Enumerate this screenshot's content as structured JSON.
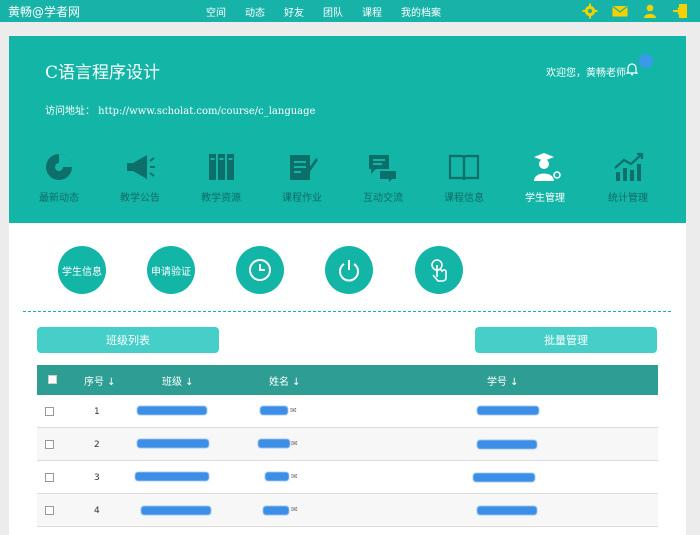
{
  "topbar": {
    "site_name": "黄畅@学者网",
    "nav": [
      "空间",
      "动态",
      "好友",
      "团队",
      "课程",
      "我的档案"
    ],
    "icons": [
      "settings-icon",
      "mail-icon",
      "user-icon",
      "logout-icon"
    ],
    "color": "#17b3a8"
  },
  "course": {
    "title": "C语言程序设计",
    "welcome": "欢迎您，黄畅老师",
    "access_url": "访问地址： http://www.scholat.com/course/c_language"
  },
  "modules": [
    {
      "label": "最新动态",
      "icon": "pie-chart-icon"
    },
    {
      "label": "教学公告",
      "icon": "megaphone-icon"
    },
    {
      "label": "教学资源",
      "icon": "binders-icon"
    },
    {
      "label": "课程作业",
      "icon": "edit-doc-icon"
    },
    {
      "label": "互动交流",
      "icon": "chat-icon"
    },
    {
      "label": "课程信息",
      "icon": "book-icon"
    },
    {
      "label": "学生管理",
      "icon": "graduate-icon",
      "active": true
    },
    {
      "label": "统计管理",
      "icon": "trend-chart-icon"
    }
  ],
  "actions": {
    "student_info": "学生信息",
    "apply_verify": "申请验证",
    "history_icon": "clock-icon",
    "power_icon": "power-icon",
    "touch_icon": "touch-icon"
  },
  "buttons": {
    "class_list": "班级列表",
    "batch_manage": "批量管理"
  },
  "table": {
    "headers": {
      "seq": "序号 ↓",
      "class": "班级 ↓",
      "name": "姓名 ↓",
      "student_id": "学号 ↓"
    },
    "rows": [
      {
        "seq": "1"
      },
      {
        "seq": "2"
      },
      {
        "seq": "3"
      },
      {
        "seq": "4"
      }
    ]
  },
  "accent_color": "#13b5a7"
}
